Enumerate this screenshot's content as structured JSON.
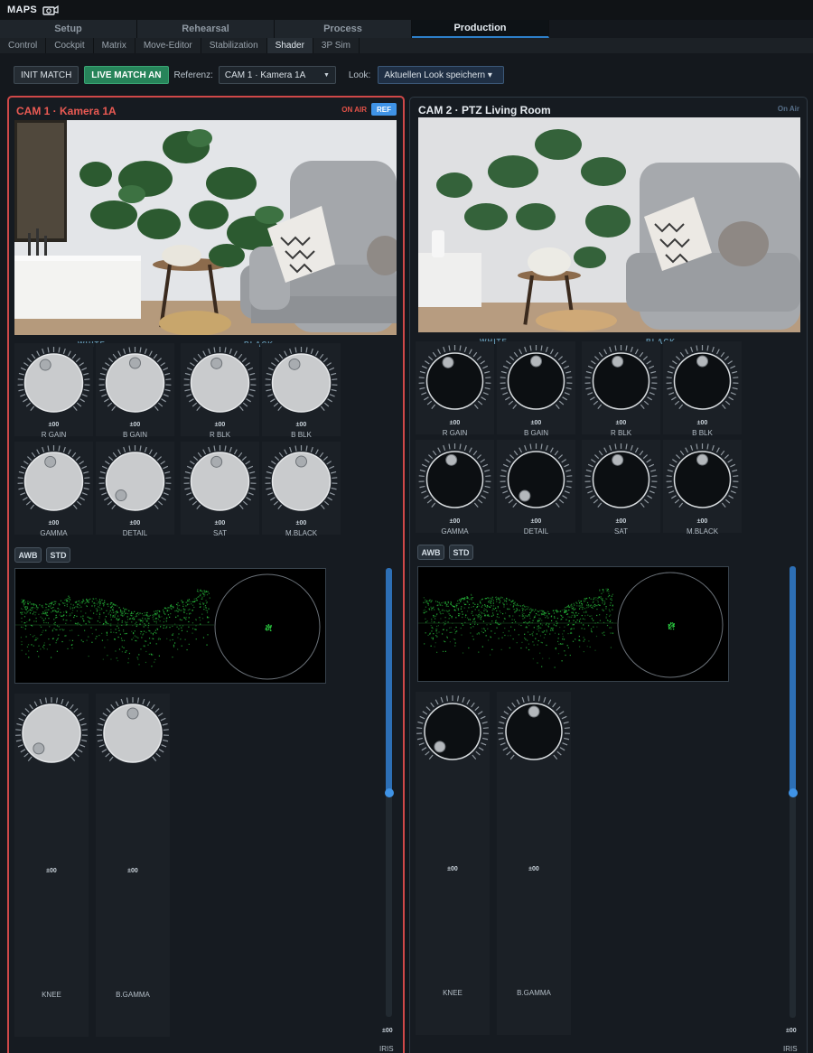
{
  "app": {
    "name": "MAPS",
    "logo_icon": "camera-logo-icon"
  },
  "main_tabs": [
    {
      "label": "Setup"
    },
    {
      "label": "Rehearsal"
    },
    {
      "label": "Process"
    },
    {
      "label": "Production",
      "active": true
    }
  ],
  "sub_tabs": [
    {
      "label": "Control"
    },
    {
      "label": "Cockpit"
    },
    {
      "label": "Matrix"
    },
    {
      "label": "Move-Editor"
    },
    {
      "label": "Stabilization"
    },
    {
      "label": "Shader",
      "active": true
    },
    {
      "label": "3P Sim"
    }
  ],
  "toolbar": {
    "init_match": "INIT MATCH",
    "live_match": "LIVE MATCH AN",
    "reference_label": "Referenz:",
    "reference_value": "CAM 1 · Kamera 1A",
    "look_label": "Look:",
    "look_value": "Aktuellen Look speichern ▾"
  },
  "colors": {
    "on_air_red": "#cf4848",
    "accent_blue": "#3f93e6",
    "live_green": "#27845a",
    "scope_green": "#29c33e"
  },
  "cameras": [
    {
      "title": "CAM 1 · Kamera 1A",
      "status": "ON AIR",
      "ref_badge": "REF",
      "on_air": true,
      "section_white": "WHITE",
      "section_black": "BLACK",
      "knobs_row1": [
        {
          "value": "±00",
          "label": "R GAIN"
        },
        {
          "value": "±00",
          "label": "B GAIN"
        },
        {
          "value": "±00",
          "label": "R BLK"
        },
        {
          "value": "±00",
          "label": "B BLK"
        }
      ],
      "knobs_row2": [
        {
          "value": "±00",
          "label": "GAMMA"
        },
        {
          "value": "±00",
          "label": "DETAIL"
        },
        {
          "value": "±00",
          "label": "SAT"
        },
        {
          "value": "±00",
          "label": "M.BLACK"
        }
      ],
      "awb": "AWB",
      "std": "STD",
      "knobs_lower": [
        {
          "value": "±00",
          "label": "KNEE"
        },
        {
          "value": "±00",
          "label": "B.GAMMA"
        }
      ],
      "iris": {
        "value": "±00",
        "label": "IRIS",
        "level": 0.2
      }
    },
    {
      "title": "CAM 2 · PTZ Living Room",
      "status": "On Air",
      "on_air": false,
      "section_white": "WHITE",
      "section_black": "BLACK",
      "knobs_row1": [
        {
          "value": "±00",
          "label": "R GAIN"
        },
        {
          "value": "±00",
          "label": "B GAIN"
        },
        {
          "value": "±00",
          "label": "R BLK"
        },
        {
          "value": "±00",
          "label": "B BLK"
        }
      ],
      "knobs_row2": [
        {
          "value": "±00",
          "label": "GAMMA"
        },
        {
          "value": "±00",
          "label": "DETAIL"
        },
        {
          "value": "±00",
          "label": "SAT"
        },
        {
          "value": "±00",
          "label": "M.BLACK"
        }
      ],
      "awb": "AWB",
      "std": "STD",
      "knobs_lower": [
        {
          "value": "±00",
          "label": "KNEE"
        },
        {
          "value": "±00",
          "label": "B.GAMMA"
        }
      ],
      "iris": {
        "value": "±00",
        "label": "IRIS",
        "level": 0.2
      }
    }
  ]
}
